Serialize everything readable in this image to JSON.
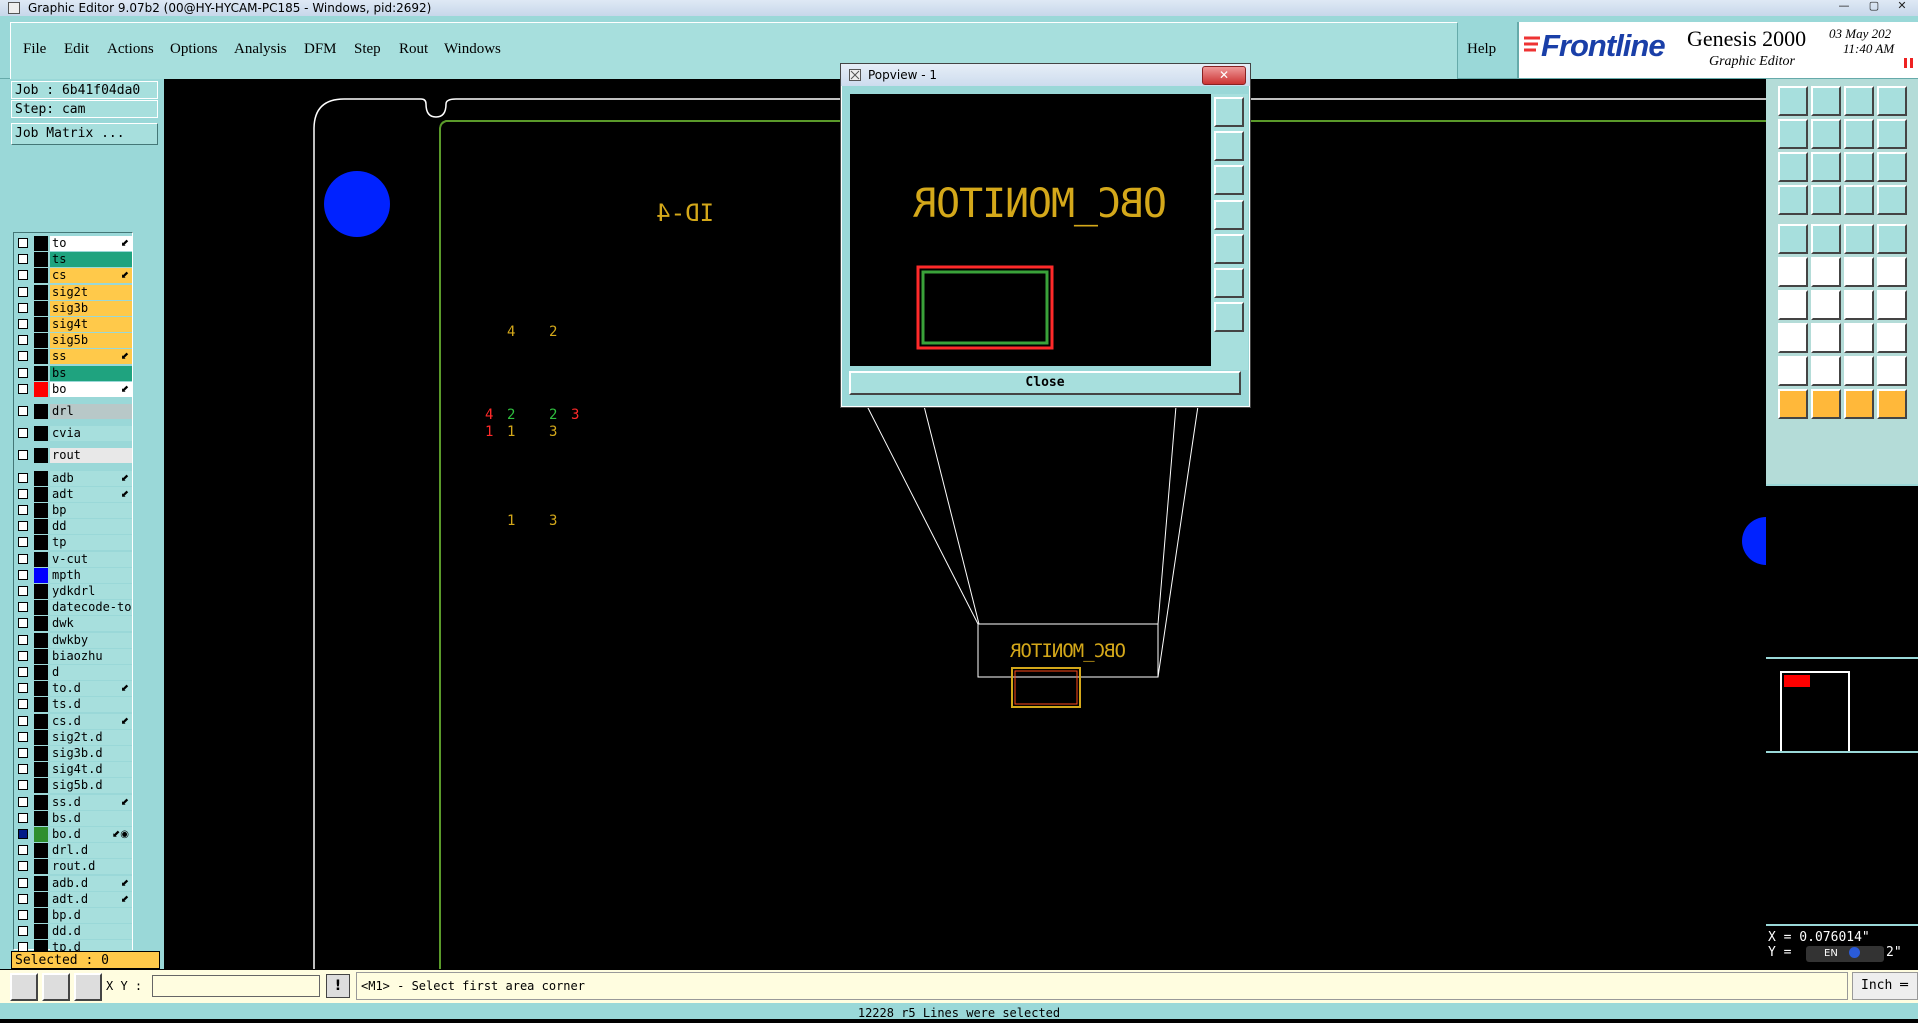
{
  "window": {
    "title": "Graphic Editor 9.07b2 (00@HY-HYCAM-PC185 - Windows, pid:2692)"
  },
  "menu": {
    "items": [
      "File",
      "Edit",
      "Actions",
      "Options",
      "Analysis",
      "DFM",
      "Step",
      "Rout",
      "Windows"
    ],
    "help": "Help"
  },
  "brand": {
    "logo": "Frontline",
    "product": "Genesis 2000",
    "subtitle": "Graphic Editor",
    "date": "03 May 202",
    "time": "11:40 AM"
  },
  "job": {
    "job_label": "Job : 6b41f04da0",
    "step_label": "Step: cam",
    "matrix_button": "Job Matrix ..."
  },
  "layers": [
    {
      "name": "to",
      "bg": "#ffffff",
      "sw": "#000000",
      "mk": "⬋"
    },
    {
      "name": "ts",
      "bg": "#1fa37f",
      "sw": "#000000",
      "mk": ""
    },
    {
      "name": "cs",
      "bg": "#ffc94a",
      "sw": "#000000",
      "mk": "⬋"
    },
    {
      "name": "sig2t",
      "bg": "#ffc94a",
      "sw": "#000000",
      "mk": ""
    },
    {
      "name": "sig3b",
      "bg": "#ffc94a",
      "sw": "#000000",
      "mk": ""
    },
    {
      "name": "sig4t",
      "bg": "#ffc94a",
      "sw": "#000000",
      "mk": ""
    },
    {
      "name": "sig5b",
      "bg": "#ffc94a",
      "sw": "#000000",
      "mk": ""
    },
    {
      "name": "ss",
      "bg": "#ffc94a",
      "sw": "#000000",
      "mk": "⬋"
    },
    {
      "name": "bs",
      "bg": "#1fa37f",
      "sw": "#000000",
      "mk": ""
    },
    {
      "name": "bo",
      "bg": "#ffffff",
      "sw": "#ff0000",
      "mk": "⬋"
    },
    {
      "name": "drl",
      "bg": "#b8c8c8",
      "sw": "#000000",
      "mk": "",
      "gap": true
    },
    {
      "name": "cvia",
      "bg": "#a7dfdd",
      "sw": "#000000",
      "mk": "",
      "gap": true
    },
    {
      "name": "rout",
      "bg": "#e8e8e8",
      "sw": "#000000",
      "mk": "",
      "gap": true
    },
    {
      "name": "adb",
      "bg": "#a7dfdd",
      "sw": "#000000",
      "mk": "⬋",
      "gap": true
    },
    {
      "name": "adt",
      "bg": "#a7dfdd",
      "sw": "#000000",
      "mk": "⬋"
    },
    {
      "name": "bp",
      "bg": "#a7dfdd",
      "sw": "#000000",
      "mk": ""
    },
    {
      "name": "dd",
      "bg": "#a7dfdd",
      "sw": "#000000",
      "mk": ""
    },
    {
      "name": "tp",
      "bg": "#a7dfdd",
      "sw": "#000000",
      "mk": ""
    },
    {
      "name": "v-cut",
      "bg": "#a7dfdd",
      "sw": "#000000",
      "mk": ""
    },
    {
      "name": "mpth",
      "bg": "#a7dfdd",
      "sw": "#0000ff",
      "mk": ""
    },
    {
      "name": "ydkdrl",
      "bg": "#a7dfdd",
      "sw": "#000000",
      "mk": ""
    },
    {
      "name": "datecode-to",
      "bg": "#a7dfdd",
      "sw": "#000000",
      "mk": ""
    },
    {
      "name": "dwk",
      "bg": "#a7dfdd",
      "sw": "#000000",
      "mk": ""
    },
    {
      "name": "dwkby",
      "bg": "#a7dfdd",
      "sw": "#000000",
      "mk": ""
    },
    {
      "name": "biaozhu",
      "bg": "#a7dfdd",
      "sw": "#000000",
      "mk": ""
    },
    {
      "name": "d",
      "bg": "#a7dfdd",
      "sw": "#000000",
      "mk": ""
    },
    {
      "name": "to.d",
      "bg": "#a7dfdd",
      "sw": "#000000",
      "mk": "⬋"
    },
    {
      "name": "ts.d",
      "bg": "#a7dfdd",
      "sw": "#000000",
      "mk": ""
    },
    {
      "name": "cs.d",
      "bg": "#a7dfdd",
      "sw": "#000000",
      "mk": "⬋"
    },
    {
      "name": "sig2t.d",
      "bg": "#a7dfdd",
      "sw": "#000000",
      "mk": ""
    },
    {
      "name": "sig3b.d",
      "bg": "#a7dfdd",
      "sw": "#000000",
      "mk": ""
    },
    {
      "name": "sig4t.d",
      "bg": "#a7dfdd",
      "sw": "#000000",
      "mk": ""
    },
    {
      "name": "sig5b.d",
      "bg": "#a7dfdd",
      "sw": "#000000",
      "mk": ""
    },
    {
      "name": "ss.d",
      "bg": "#a7dfdd",
      "sw": "#000000",
      "mk": "⬋"
    },
    {
      "name": "bs.d",
      "bg": "#a7dfdd",
      "sw": "#000000",
      "mk": ""
    },
    {
      "name": "bo.d",
      "bg": "#a7dfdd",
      "sw": "#2f8f2f",
      "mk": "⬋◉",
      "on": true
    },
    {
      "name": "drl.d",
      "bg": "#a7dfdd",
      "sw": "#000000",
      "mk": ""
    },
    {
      "name": "rout.d",
      "bg": "#a7dfdd",
      "sw": "#000000",
      "mk": ""
    },
    {
      "name": "adb.d",
      "bg": "#a7dfdd",
      "sw": "#000000",
      "mk": "⬋"
    },
    {
      "name": "adt.d",
      "bg": "#a7dfdd",
      "sw": "#000000",
      "mk": "⬋"
    },
    {
      "name": "bp.d",
      "bg": "#a7dfdd",
      "sw": "#000000",
      "mk": ""
    },
    {
      "name": "dd.d",
      "bg": "#a7dfdd",
      "sw": "#000000",
      "mk": ""
    },
    {
      "name": "tp.d",
      "bg": "#a7dfdd",
      "sw": "#000000",
      "mk": ""
    }
  ],
  "selected_label": "Selected : 0",
  "canvas": {
    "id_text": "ID-4",
    "pins": [
      "4",
      "2",
      "4",
      "2",
      "2",
      "3",
      "1",
      "3",
      "1",
      "3",
      "1"
    ],
    "zoom_text": "OBC_MONITOR"
  },
  "popup": {
    "title": "Popview - 1",
    "close_label": "Close",
    "text": "OBC_MONITOR"
  },
  "coords": {
    "x": "X = 0.076014\"",
    "y": "Y =",
    "y_tail": "2\"",
    "ime": "EN"
  },
  "status": {
    "xy_label": "X Y :",
    "xy_value": "",
    "prompt": "<M1> - Select first area corner",
    "units": "Inch",
    "message": "12228 r5 Lines were selected"
  },
  "colors": {
    "panel": "#9ad8d8",
    "signal_layer": "#ffc94a",
    "mask_layer": "#1fa37f",
    "board_outline": "#5a9a2a",
    "text_gold": "#d4a81a",
    "highlight_red": "#ff2a2a"
  }
}
